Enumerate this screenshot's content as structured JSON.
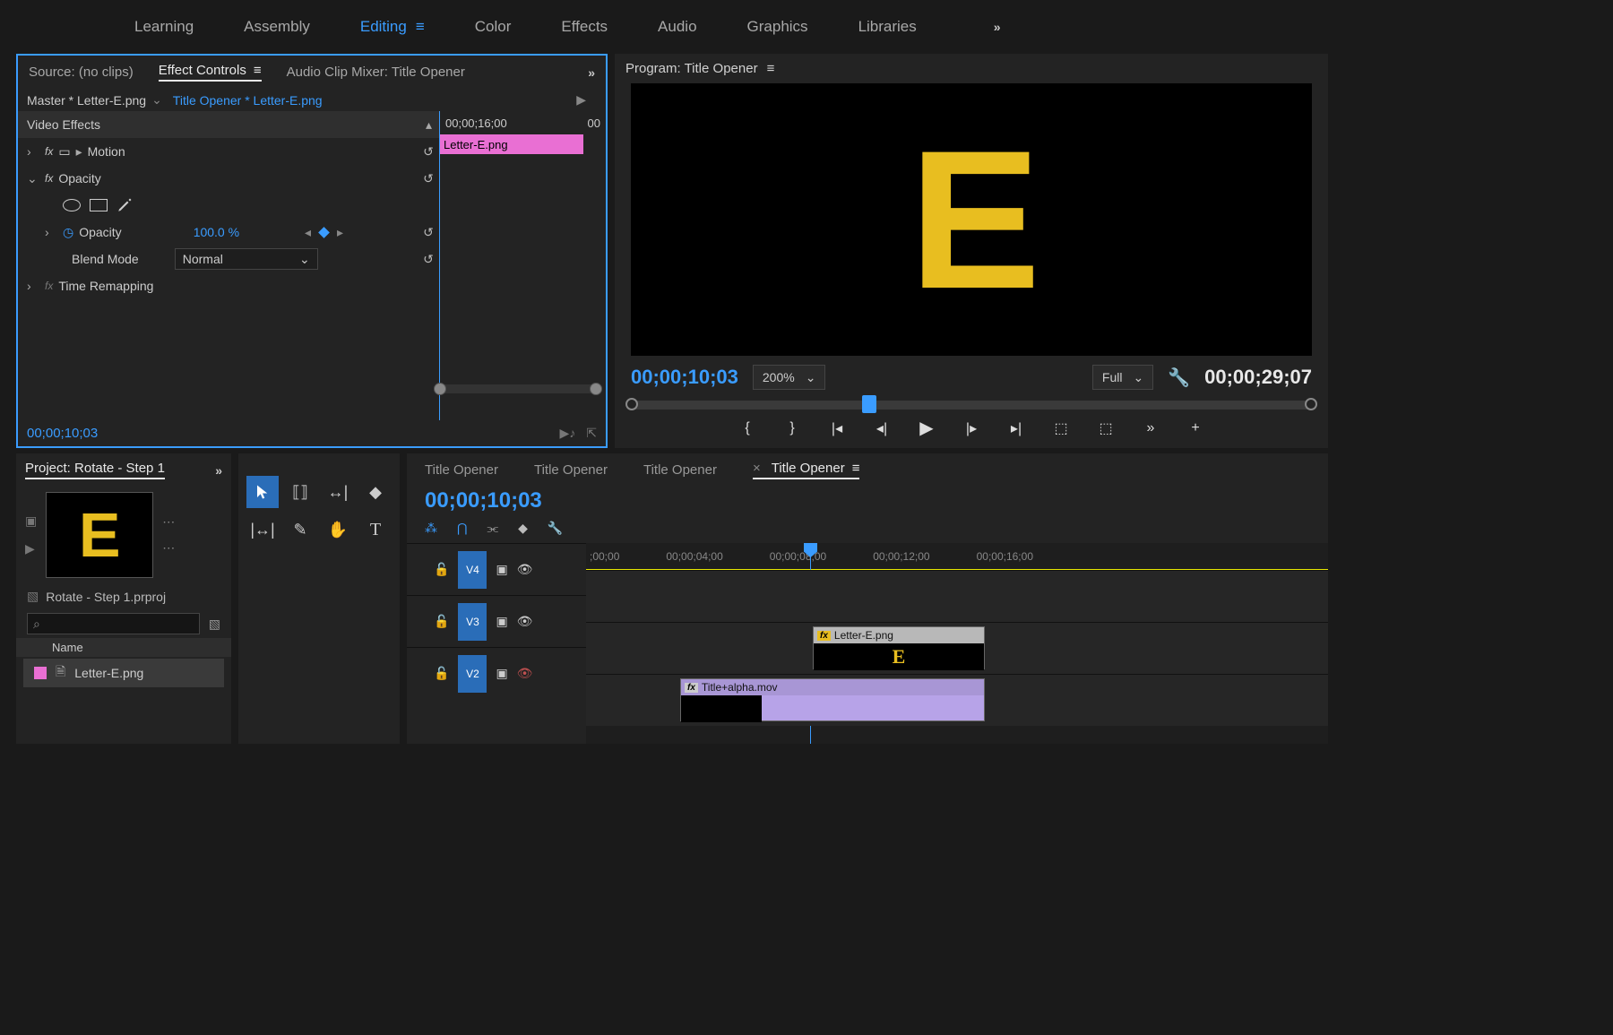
{
  "workspace": {
    "tabs": [
      "Learning",
      "Assembly",
      "Editing",
      "Color",
      "Effects",
      "Audio",
      "Graphics",
      "Libraries"
    ],
    "active": "Editing"
  },
  "sourcePanel": {
    "tabs": {
      "source": "Source: (no clips)",
      "effectControls": "Effect Controls",
      "audioMixer": "Audio Clip Mixer: Title Opener"
    },
    "master": "Master * Letter-E.png",
    "sequence": "Title Opener * Letter-E.png",
    "rulerTc": "00;00;16;00",
    "rulerEnd": "00",
    "clipName": "Letter-E.png",
    "sections": {
      "videoEffects": "Video Effects",
      "motion": "Motion",
      "opacity": "Opacity",
      "opacityProp": "Opacity",
      "opacityVal": "100.0 %",
      "blendMode": "Blend Mode",
      "blendVal": "Normal",
      "timeRemap": "Time Remapping"
    },
    "footerTc": "00;00;10;03"
  },
  "program": {
    "title": "Program: Title Opener",
    "tc": "00;00;10;03",
    "zoom": "200%",
    "res": "Full",
    "duration": "00;00;29;07"
  },
  "project": {
    "title": "Project: Rotate - Step 1",
    "fileName": "Rotate - Step 1.prproj",
    "nameHeader": "Name",
    "itemName": "Letter-E.png"
  },
  "timeline": {
    "tabs": [
      "Title Opener",
      "Title Opener",
      "Title Opener",
      "Title Opener"
    ],
    "tc": "00;00;10;03",
    "ruler": [
      ";00;00",
      "00;00;04;00",
      "00;00;08;00",
      "00;00;12;00",
      "00;00;16;00"
    ],
    "tracks": {
      "v4": "V4",
      "v3": "V3",
      "v2": "V2"
    },
    "clip1": "Letter-E.png",
    "clip2": "Title+alpha.mov"
  }
}
